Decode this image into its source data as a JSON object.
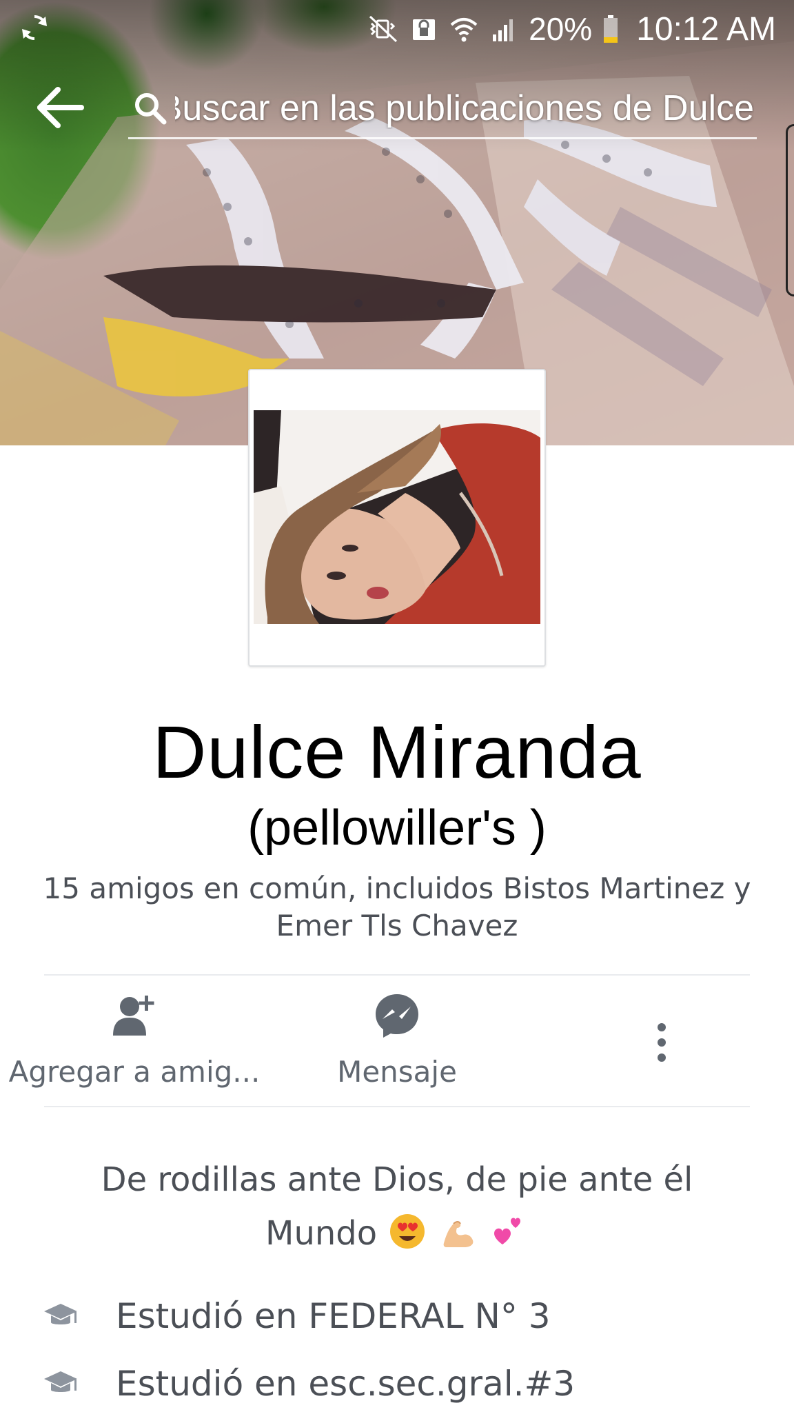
{
  "status_bar": {
    "battery": "20%",
    "time": "10:12 AM",
    "icons": [
      "sync-icon",
      "mute-vibrate-icon",
      "lock-icon",
      "wifi-icon",
      "signal-icon",
      "battery-icon"
    ]
  },
  "header": {
    "search_placeholder": "Buscar en las publicaciones de Dulce",
    "back_icon": "arrow-left-icon"
  },
  "profile": {
    "name": "Dulce Miranda",
    "alternate_name": "(pellowiller's )",
    "mutual_friends": "15 amigos en común, incluidos Bistos Martinez y Emer Tls Chavez"
  },
  "actions": [
    {
      "label": "Agregar a amig...",
      "icon": "add-friend-icon"
    },
    {
      "label": "Mensaje",
      "icon": "messenger-icon"
    },
    {
      "label": "",
      "icon": "more-vertical-icon"
    }
  ],
  "bio": {
    "line1": "De rodillas ante Dios, de pie ante él",
    "line2": "Mundo",
    "emojis": [
      "heart-eyes-emoji",
      "flexed-biceps-emoji",
      "two-hearts-emoji"
    ]
  },
  "info": [
    {
      "icon": "graduation-cap-icon",
      "text": "Estudió en FEDERAL N° 3"
    },
    {
      "icon": "graduation-cap-icon",
      "text": "Estudió en esc.sec.gral.#3"
    }
  ],
  "colors": {
    "text_primary": "#000000",
    "text_secondary": "#4b4f56",
    "icon_gray": "#606770",
    "divider": "#e9ebee",
    "background": "#ffffff"
  }
}
